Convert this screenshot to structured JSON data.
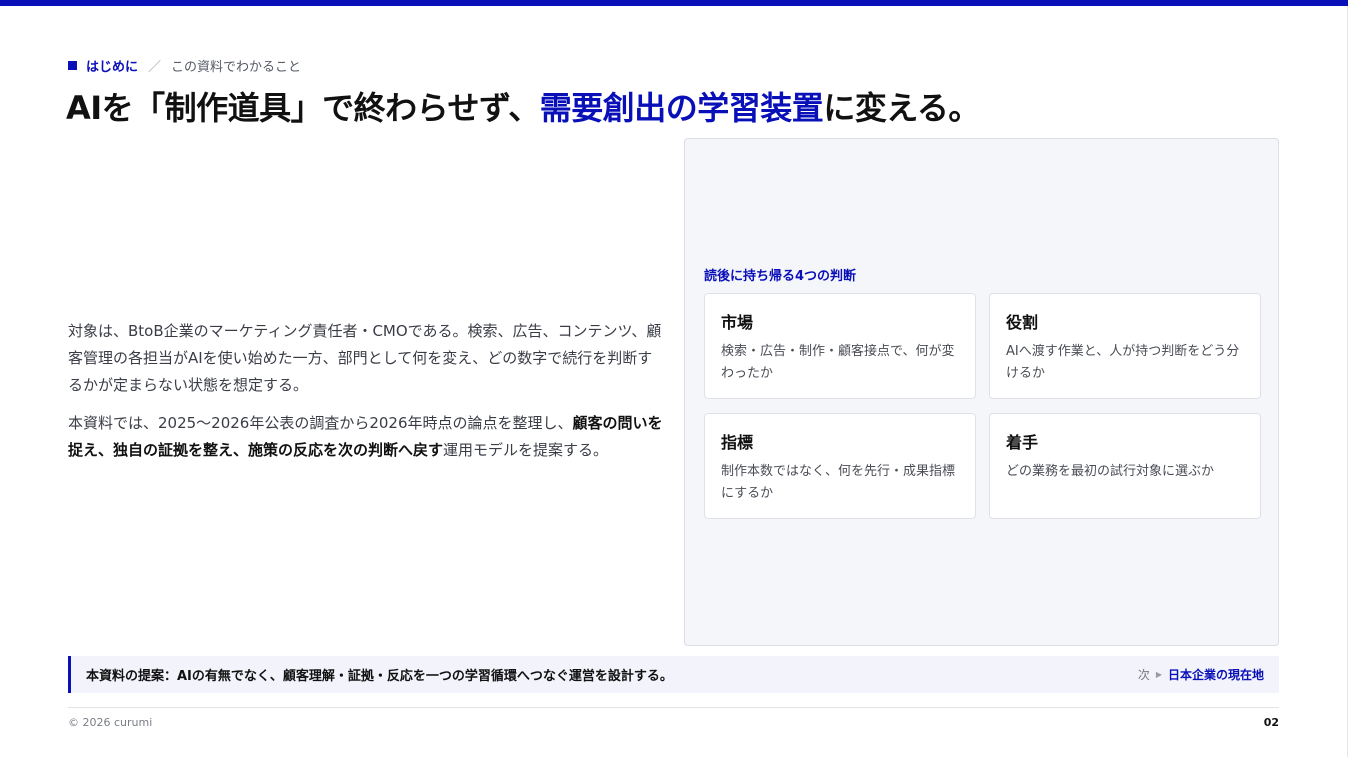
{
  "colors": {
    "accent": "#0a10b8",
    "text": "#1a1a1a",
    "panel_bg": "#f5f6fa"
  },
  "header": {
    "section_icon": "square-icon",
    "section": "はじめに",
    "separator": "／",
    "subsection": "この資料でわかること"
  },
  "title": {
    "part1": "AIを「制作道具」で終わらせず、",
    "highlight": "需要創出の学習装置",
    "part2": "に変える。"
  },
  "intro": {
    "p1": "対象は、BtoB企業のマーケティング責任者・CMOである。検索、広告、コンテンツ、顧客管理の各担当がAIを使い始めた一方、部門として何を変え、どの数字で続行を判断するかが定まらない状態を想定する。",
    "p2_pre": "本資料では、2025〜2026年公表の調査から2026年時点の論点を整理し、",
    "p2_bold": "顧客の問いを捉え、独自の証拠を整え、施策の反応を次の判断へ戻す",
    "p2_post": "運用モデルを提案する。"
  },
  "panel": {
    "heading": "読後に持ち帰る4つの判断",
    "cards": [
      {
        "title": "市場",
        "desc": "検索・広告・制作・顧客接点で、何が変わったか"
      },
      {
        "title": "役割",
        "desc": "AIへ渡す作業と、人が持つ判断をどう分けるか"
      },
      {
        "title": "指標",
        "desc": "制作本数ではなく、何を先行・成果指標にするか"
      },
      {
        "title": "着手",
        "desc": "どの業務を最初の試行対象に選ぶか"
      }
    ]
  },
  "summary": {
    "text": "本資料の提案：AIの有無でなく、顧客理解・証拠・反応を一つの学習循環へつなぐ運営を設計する。",
    "next_label": "次",
    "next_icon": "triangle-right-icon",
    "next_title": "日本企業の現在地"
  },
  "footer": {
    "copyright": "© 2026 curumi",
    "page_number": "02"
  }
}
